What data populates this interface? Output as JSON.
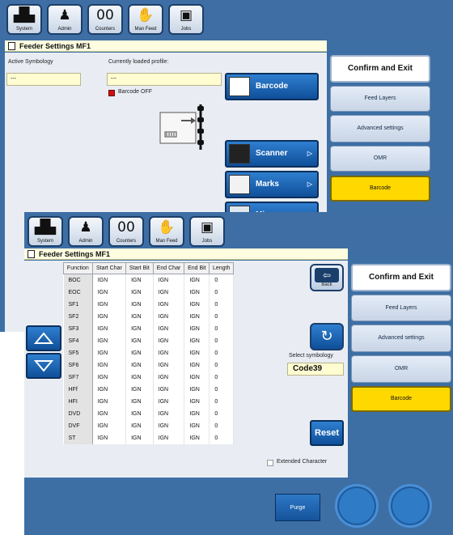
{
  "nav": [
    {
      "label": "System",
      "glyph": "▟▙"
    },
    {
      "label": "Admin",
      "glyph": "♟"
    },
    {
      "label": "Counters",
      "glyph": "00"
    },
    {
      "label": "Man Feed",
      "glyph": "✋"
    },
    {
      "label": "Jobs",
      "glyph": "▣"
    }
  ],
  "window1": {
    "title": "Feeder Settings MF1",
    "active_symbology_label": "Active Symbology",
    "active_symbology_value": "---",
    "loaded_profile_label": "Currently loaded profile:",
    "loaded_profile_value": "---",
    "barcode_status": "Barcode OFF",
    "buttons": {
      "barcode": "Barcode",
      "scanner": "Scanner",
      "marks": "Marks",
      "misc": "Misc"
    }
  },
  "side_menu": {
    "confirm": "Confirm and Exit",
    "feed_layers": "Feed Layers",
    "advanced": "Advanced settings",
    "omr": "OMR",
    "barcode": "Barcode"
  },
  "window2": {
    "title": "Feeder Settings MF1",
    "columns": [
      "Function",
      "Start Char",
      "Start Bit",
      "End Char",
      "End Bit",
      "Length"
    ],
    "rows": [
      [
        "BOC",
        "IGN",
        "IGN",
        "IGN",
        "IGN",
        "0"
      ],
      [
        "EOC",
        "IGN",
        "IGN",
        "IGN",
        "IGN",
        "0"
      ],
      [
        "SF1",
        "IGN",
        "IGN",
        "IGN",
        "IGN",
        "0"
      ],
      [
        "SF2",
        "IGN",
        "IGN",
        "IGN",
        "IGN",
        "0"
      ],
      [
        "SF3",
        "IGN",
        "IGN",
        "IGN",
        "IGN",
        "0"
      ],
      [
        "SF4",
        "IGN",
        "IGN",
        "IGN",
        "IGN",
        "0"
      ],
      [
        "SF5",
        "IGN",
        "IGN",
        "IGN",
        "IGN",
        "0"
      ],
      [
        "SF6",
        "IGN",
        "IGN",
        "IGN",
        "IGN",
        "0"
      ],
      [
        "SF7",
        "IGN",
        "IGN",
        "IGN",
        "IGN",
        "0"
      ],
      [
        "HFf",
        "IGN",
        "IGN",
        "IGN",
        "IGN",
        "0"
      ],
      [
        "HFI",
        "IGN",
        "IGN",
        "IGN",
        "IGN",
        "0"
      ],
      [
        "DVD",
        "IGN",
        "IGN",
        "IGN",
        "IGN",
        "0"
      ],
      [
        "DVF",
        "IGN",
        "IGN",
        "IGN",
        "IGN",
        "0"
      ],
      [
        "ST",
        "IGN",
        "IGN",
        "IGN",
        "IGN",
        "0"
      ]
    ],
    "back_label": "Back",
    "select_symbology_label": "Select symbology",
    "symbology_value": "Code39",
    "reset_label": "Reset",
    "extended_char_label": "Extended Character",
    "purge_label": "Purge"
  },
  "colors": {
    "accent": "#ffd800",
    "window_bg": "#3d6fa5",
    "field_bg": "#fffcd2",
    "status_red": "#cc1111"
  }
}
